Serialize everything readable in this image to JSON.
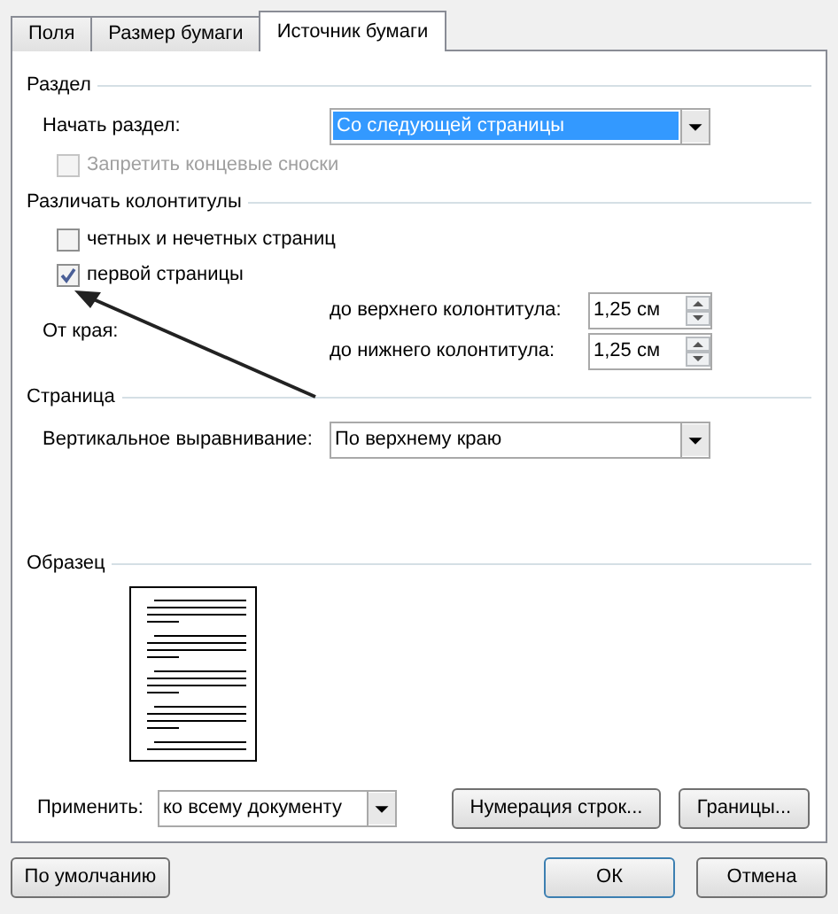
{
  "tabs": [
    {
      "label": "Поля",
      "selected": false
    },
    {
      "label": "Размер бумаги",
      "selected": false
    },
    {
      "label": "Источник бумаги",
      "selected": true
    }
  ],
  "section": {
    "title": "Раздел",
    "start_label": "Начать раздел:",
    "start_value": "Со следующей страницы",
    "suppress_endnotes": {
      "label": "Запретить концевые сноски",
      "checked": false,
      "disabled": true
    }
  },
  "headers_footers": {
    "title": "Различать колонтитулы",
    "options": [
      {
        "label": "четных и нечетных страниц",
        "checked": false
      },
      {
        "label": "первой страницы",
        "checked": true
      }
    ],
    "from_edge_label": "От края:",
    "fields": [
      {
        "label": "до верхнего колонтитула:",
        "value": "1,25 см"
      },
      {
        "label": "до нижнего колонтитула:",
        "value": "1,25 см"
      }
    ]
  },
  "page": {
    "title": "Страница",
    "valign_label": "Вертикальное выравнивание:",
    "valign_value": "По верхнему краю"
  },
  "preview": {
    "title": "Образец"
  },
  "apply": {
    "label": "Применить:",
    "value": "ко всему документу"
  },
  "panel_buttons": [
    "Нумерация строк...",
    "Границы..."
  ],
  "footer_buttons": [
    {
      "label": "По умолчанию",
      "kind": "plain"
    },
    {
      "label": "ОК",
      "kind": "default"
    },
    {
      "label": "Отмена",
      "kind": "plain"
    }
  ]
}
